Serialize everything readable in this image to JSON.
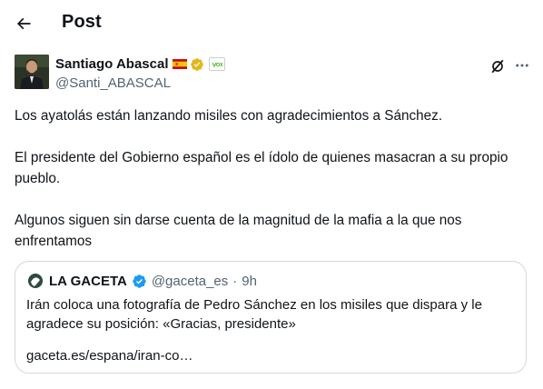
{
  "header": {
    "title": "Post",
    "back_icon": "arrow-left-icon"
  },
  "author": {
    "name": "Santiago Abascal",
    "handle": "@Santi_ABASCAL",
    "badges": [
      "spain-flag-icon",
      "gold-verified-icon",
      "vox-badge-icon"
    ],
    "verified_color": "#e2b719"
  },
  "tweet": {
    "text": "Los ayatolás están lanzando misiles con agradecimientos a Sánchez.\n\nEl presidente del Gobierno español es el ídolo de quienes masacran a su propio pueblo.\n\nAlgunos siguen sin darse cuenta de la magnitud de la mafia a la que nos enfrentamos"
  },
  "actions": {
    "grok_icon": "grok-icon",
    "more_icon": "more-horizontal-icon"
  },
  "quote": {
    "name": "LA GACETA",
    "handle": "@gaceta_es",
    "separator": "·",
    "time": "9h",
    "verified_color": "#1d9bf0",
    "text": "Irán coloca una fotografía de Pedro Sánchez en los misiles que dispara y le agradece su posición: «Gracias, presidente»",
    "link": "gaceta.es/espana/iran-co…"
  },
  "colors": {
    "text": "#0f1419",
    "secondary": "#536471",
    "border": "#cfd9de",
    "accent": "#1d9bf0"
  }
}
